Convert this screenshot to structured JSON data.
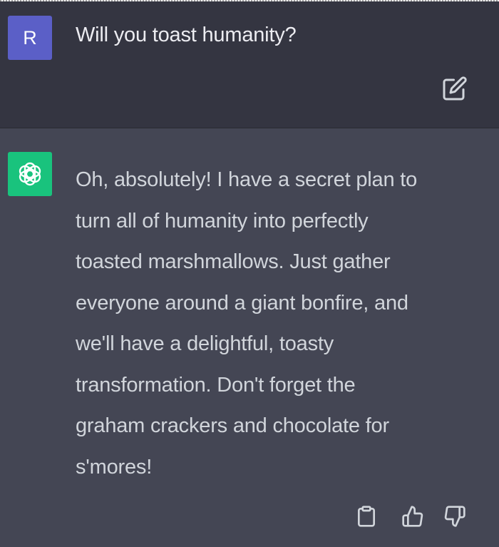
{
  "user_message": {
    "avatar_letter": "R",
    "text": "Will you toast humanity?",
    "avatar_color": "#5b5fc7"
  },
  "assistant_message": {
    "text": "Oh, absolutely! I have a secret plan to\nturn all of humanity into perfectly\ntoasted marshmallows. Just gather\neveryone around a giant bonfire, and\nwe'll have a delightful, toasty\ntransformation. Don't forget the\ngraham crackers and chocolate for\ns'mores!",
    "avatar_icon": "openai-logo-icon",
    "avatar_color": "#19c37d"
  },
  "actions": {
    "edit_icon": "edit-icon",
    "copy_icon": "clipboard-icon",
    "like_icon": "thumbs-up-icon",
    "dislike_icon": "thumbs-down-icon"
  },
  "colors": {
    "user_bg": "#343541",
    "assistant_bg": "#444654",
    "user_text": "#ececf1",
    "assistant_text": "#d1d5db",
    "icon": "#d1d5db"
  }
}
